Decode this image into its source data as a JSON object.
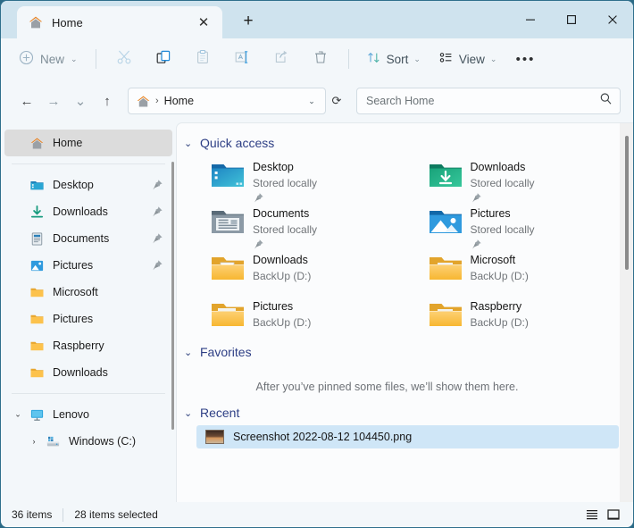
{
  "window": {
    "tab_title": "Home",
    "tab_icon": "home-icon",
    "close_tab_glyph": "✕",
    "new_tab_glyph": "+",
    "minimize_glyph": "—",
    "maximize_glyph": "▢",
    "close_glyph": "✕"
  },
  "toolbar": {
    "new_label": "New",
    "new_icon": "plus-circle-icon",
    "cut_icon": "scissors-icon",
    "copy_icon": "copy-icon",
    "paste_icon": "clipboard-icon",
    "rename_icon": "rename-icon",
    "share_icon": "share-icon",
    "delete_icon": "trash-icon",
    "sort_label": "Sort",
    "sort_icon": "sort-arrows-icon",
    "view_label": "View",
    "view_icon": "view-list-icon",
    "more_label": "•••",
    "caret": "⌄"
  },
  "addressbar": {
    "back_glyph": "←",
    "forward_glyph": "→",
    "recent_glyph": "⌄",
    "up_glyph": "↑",
    "breadcrumb_icon": "home-icon",
    "breadcrumb_sep": "›",
    "breadcrumb_text": "Home",
    "breadcrumb_caret": "⌄",
    "refresh_glyph": "⟳",
    "search_placeholder": "Search Home",
    "search_icon": "search-icon"
  },
  "sidebar": {
    "items": [
      {
        "label": "Home",
        "icon": "home-icon",
        "selected": true,
        "pinned": false,
        "level": 1,
        "chevron": ""
      },
      {
        "label": "Desktop",
        "icon": "desktop-folder-icon",
        "selected": false,
        "pinned": true,
        "level": 1,
        "chevron": ""
      },
      {
        "label": "Downloads",
        "icon": "downloads-arrow-icon",
        "selected": false,
        "pinned": true,
        "level": 1,
        "chevron": ""
      },
      {
        "label": "Documents",
        "icon": "documents-icon",
        "selected": false,
        "pinned": true,
        "level": 1,
        "chevron": ""
      },
      {
        "label": "Pictures",
        "icon": "pictures-icon",
        "selected": false,
        "pinned": true,
        "level": 1,
        "chevron": ""
      },
      {
        "label": "Microsoft",
        "icon": "yellow-folder-icon",
        "selected": false,
        "pinned": false,
        "level": 1,
        "chevron": ""
      },
      {
        "label": "Pictures",
        "icon": "yellow-folder-icon",
        "selected": false,
        "pinned": false,
        "level": 1,
        "chevron": ""
      },
      {
        "label": "Raspberry",
        "icon": "yellow-folder-icon",
        "selected": false,
        "pinned": false,
        "level": 1,
        "chevron": ""
      },
      {
        "label": "Downloads",
        "icon": "yellow-folder-icon",
        "selected": false,
        "pinned": false,
        "level": 1,
        "chevron": ""
      }
    ],
    "tree": [
      {
        "label": "Lenovo",
        "icon": "monitor-icon",
        "chevron": "⌄",
        "level": 1
      },
      {
        "label": "Windows (C:)",
        "icon": "drive-icon",
        "chevron": "›",
        "level": 2
      }
    ]
  },
  "main": {
    "quick_access": {
      "title": "Quick access",
      "chevron": "⌄",
      "items": [
        {
          "name": "Desktop",
          "sub": "Stored locally",
          "icon": "desktop-folder-icon",
          "pinned": true
        },
        {
          "name": "Downloads",
          "sub": "Stored locally",
          "icon": "downloads-folder-icon",
          "pinned": true
        },
        {
          "name": "Documents",
          "sub": "Stored locally",
          "icon": "documents-folder-icon",
          "pinned": true
        },
        {
          "name": "Pictures",
          "sub": "Stored locally",
          "icon": "pictures-folder-icon",
          "pinned": true
        },
        {
          "name": "Downloads",
          "sub": "BackUp (D:)",
          "icon": "yellow-folder-doc-icon",
          "pinned": false
        },
        {
          "name": "Microsoft",
          "sub": "BackUp (D:)",
          "icon": "yellow-folder-thumb-icon",
          "pinned": false
        },
        {
          "name": "Pictures",
          "sub": "BackUp (D:)",
          "icon": "yellow-folder-photo-icon",
          "pinned": false
        },
        {
          "name": "Raspberry",
          "sub": "BackUp (D:)",
          "icon": "yellow-folder-thumb-icon",
          "pinned": false
        }
      ]
    },
    "favorites": {
      "title": "Favorites",
      "chevron": "⌄",
      "empty_message": "After you’ve pinned some files, we’ll show them here."
    },
    "recent": {
      "title": "Recent",
      "chevron": "⌄",
      "items": [
        {
          "name": "Screenshot 2022-08-12 104450.png",
          "selected": true,
          "icon": "image-thumbnail"
        }
      ]
    }
  },
  "statusbar": {
    "item_count": "36 items",
    "selection_count": "28 items selected",
    "details_view_icon": "details-view-icon",
    "large_icons_view_icon": "large-icons-view-icon"
  },
  "colors": {
    "titlebar": "#cfe3ee",
    "chrome": "#f3f7fa",
    "content": "#fbfcfd",
    "group_heading": "#2e3f85",
    "selection": "#cfe6f7",
    "sidebar_selected": "#dcdcdc",
    "folder_yellow": "#fcc24c",
    "home_orange": "#e8801e"
  }
}
